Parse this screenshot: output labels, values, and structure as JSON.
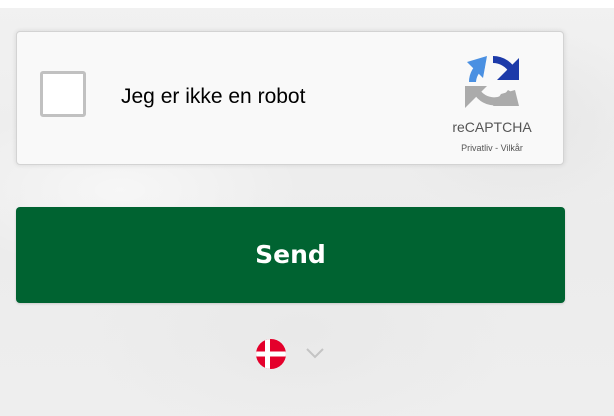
{
  "recaptcha": {
    "checkbox_label": "Jeg er ikke en robot",
    "brand": "reCAPTCHA",
    "privacy_link": "Privatliv",
    "separator": " - ",
    "terms_link": "Vilkår",
    "logo_icon": "recaptcha-logo-icon",
    "checked": false
  },
  "form": {
    "send_label": "Send"
  },
  "language": {
    "selected_flag_icon": "denmark-flag-icon",
    "dropdown_icon": "chevron-down-icon"
  },
  "colors": {
    "button": "#006331",
    "flag_red": "#E4002B",
    "flag_white": "#FFFFFF",
    "recaptcha_blue": "#1C3AA9",
    "recaptcha_light_blue": "#4A90E2",
    "recaptcha_gray": "#ABABAB"
  }
}
